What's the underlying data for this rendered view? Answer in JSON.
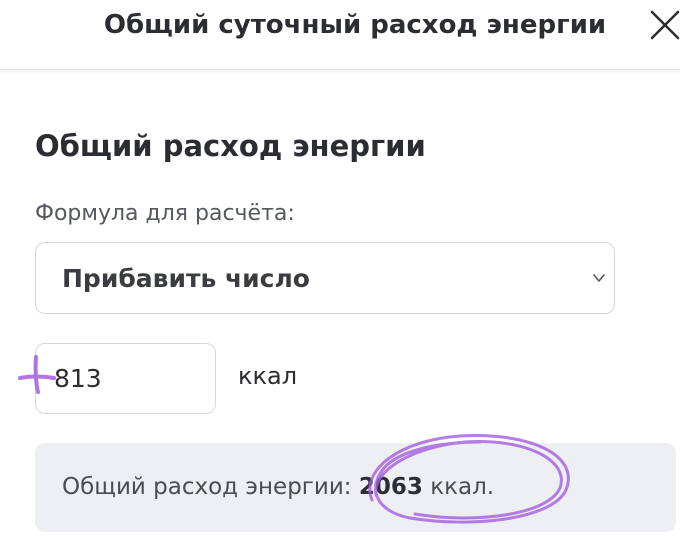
{
  "header": {
    "title": "Общий суточный расход энергии",
    "close_icon": "close-icon"
  },
  "section": {
    "title": "Общий расход энергии",
    "formula_label": "Формула для расчёта:",
    "formula_select": {
      "selected": "Прибавить число",
      "chevron_icon": "chevron-down-icon"
    },
    "amount_input": {
      "value": "813"
    },
    "unit": "ккал"
  },
  "result": {
    "label": "Общий расход энергии:",
    "value": "2063",
    "unit": "ккал."
  },
  "colors": {
    "annotation": "#a45de0",
    "result_bg": "#eeeff2",
    "border": "#d6d6dc"
  }
}
